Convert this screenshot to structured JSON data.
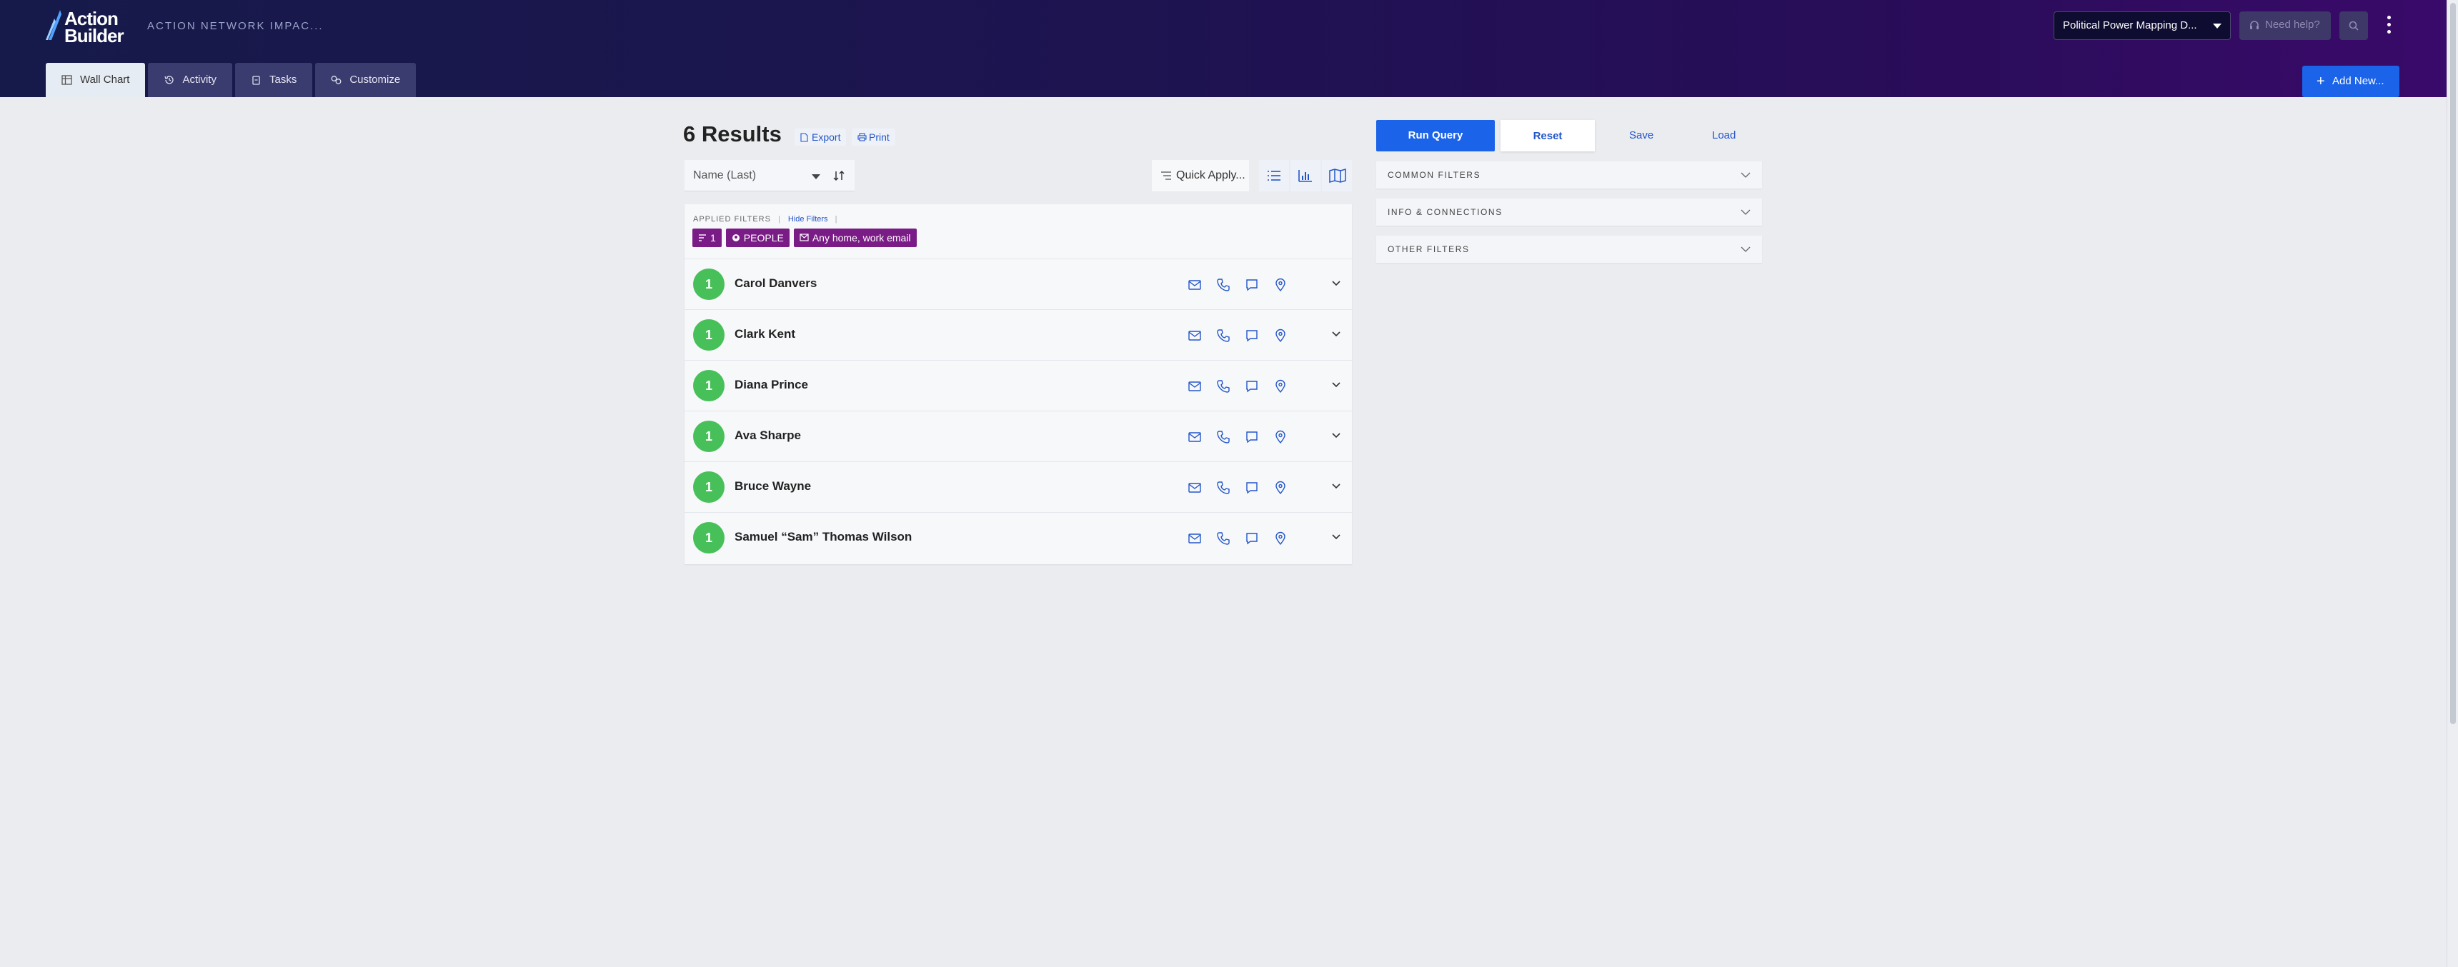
{
  "brand": {
    "logo_text": "Action Builder",
    "org_name": "ACTION NETWORK IMPAC..."
  },
  "header": {
    "workspace": "Political Power Mapping D...",
    "help_label": "Need help?",
    "add_new_label": "Add New..."
  },
  "nav": {
    "tabs": [
      {
        "label": "Wall Chart",
        "icon": "table-icon",
        "active": true
      },
      {
        "label": "Activity",
        "icon": "history-icon",
        "active": false
      },
      {
        "label": "Tasks",
        "icon": "clipboard-icon",
        "active": false
      },
      {
        "label": "Customize",
        "icon": "link-icon",
        "active": false
      }
    ]
  },
  "results": {
    "title": "6 Results",
    "export_label": "Export",
    "print_label": "Print",
    "sort_value": "Name (Last)",
    "quick_apply_label": "Quick Apply...",
    "applied_filters_label": "APPLIED FILTERS",
    "hide_filters_label": "Hide Filters",
    "chips": [
      {
        "label": "1",
        "icon": "level-icon"
      },
      {
        "label": "PEOPLE",
        "icon": "people-icon"
      },
      {
        "label": "Any home, work email",
        "icon": "mail-icon"
      }
    ],
    "people": [
      {
        "name": "Carol Danvers",
        "level": "1"
      },
      {
        "name": "Clark Kent",
        "level": "1"
      },
      {
        "name": "Diana Prince",
        "level": "1"
      },
      {
        "name": "Ava Sharpe",
        "level": "1"
      },
      {
        "name": "Bruce Wayne",
        "level": "1"
      },
      {
        "name": "Samuel “Sam” Thomas Wilson",
        "level": "1"
      }
    ]
  },
  "filters": {
    "run_query_label": "Run Query",
    "reset_label": "Reset",
    "save_label": "Save",
    "load_label": "Load",
    "sections": [
      "COMMON FILTERS",
      "INFO & CONNECTIONS",
      "OTHER FILTERS"
    ]
  },
  "colors": {
    "primary": "#1b63e8",
    "chip": "#7a1c86",
    "level_badge": "#48c05a",
    "header_start": "#161a4a",
    "header_end": "#3a0a6a"
  }
}
